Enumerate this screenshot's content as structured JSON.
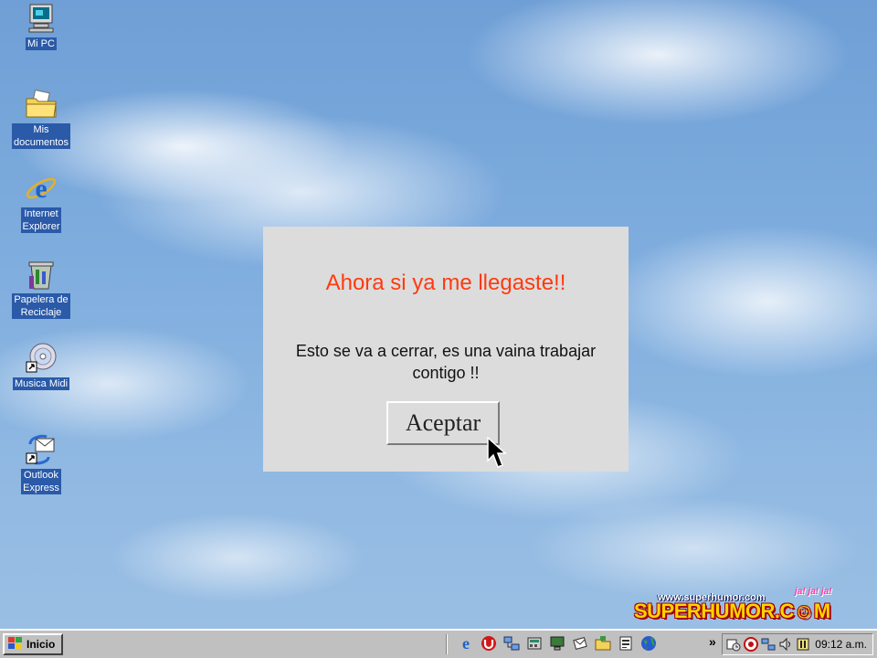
{
  "desktop": {
    "icons": [
      {
        "label": "Mi PC",
        "icon": "my-computer-icon"
      },
      {
        "label": "Mis\ndocumentos",
        "icon": "my-documents-folder-icon"
      },
      {
        "label": "Internet\nExplorer",
        "icon": "internet-explorer-icon"
      },
      {
        "label": "Papelera de\nReciclaje",
        "icon": "recycle-bin-icon"
      },
      {
        "label": "Musica Midi",
        "icon": "music-cd-shortcut-icon"
      },
      {
        "label": "Outlook\nExpress",
        "icon": "outlook-express-icon"
      }
    ]
  },
  "dialog": {
    "title": "Ahora si ya me llegaste!!",
    "message": "Esto se va a cerrar, es una vaina trabajar contigo !!",
    "button_label": "Aceptar",
    "title_color": "#ff3a10"
  },
  "logo": {
    "url": "www.superhumor.com",
    "laugh": "ja! ja! ja!",
    "wordmark": "SUPERHUMOR.C☺M"
  },
  "taskbar": {
    "start_label": "Inicio",
    "quick_launch": [
      "internet-explorer-icon",
      "antivirus-icon",
      "network-icon",
      "calculator-icon",
      "monitor-icon",
      "mail-icon",
      "folder-icon",
      "document-icon",
      "globe-icon"
    ],
    "chevron": "»",
    "tray": [
      "scheduler-icon",
      "shield-icon",
      "network-tray-icon",
      "volume-icon",
      "keyboard-icon"
    ],
    "clock": "09:12 a.m."
  }
}
